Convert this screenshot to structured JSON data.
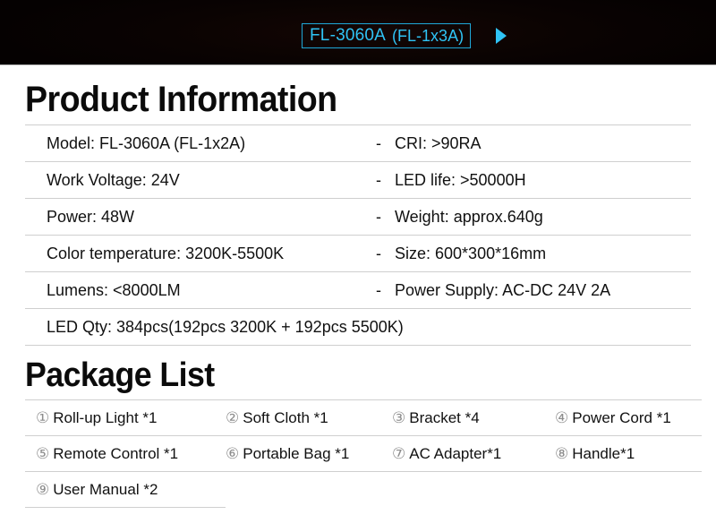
{
  "banner": {
    "model": "FL-3060A",
    "variant": "(FL-1x3A)",
    "arrow_icon": "play-triangle-icon",
    "background_color": "#060101",
    "accent_color": "#2fc3f5"
  },
  "sections": {
    "product_information": {
      "title": "Product Information",
      "rows": [
        {
          "left": "Model: FL-3060A (FL-1x2A)",
          "dash": "-",
          "right": "CRI:  >90RA"
        },
        {
          "left": "Work Voltage:  24V",
          "dash": "-",
          "right": "LED life: >50000H"
        },
        {
          "left": "Power: 48W",
          "dash": "-",
          "right": "Weight:  approx.640g"
        },
        {
          "left": "Color temperature: 3200K-5500K",
          "dash": "-",
          "right": "Size: 600*300*16mm"
        },
        {
          "left": "Lumens: <8000LM",
          "dash": "-",
          "right": "Power Supply:  AC-DC 24V 2A"
        }
      ],
      "full_width_row": "LED Qty: 384pcs(192pcs 3200K + 192pcs 5500K)"
    },
    "package_list": {
      "title": "Package List",
      "items": [
        {
          "number": "①",
          "label": "Roll-up Light *1"
        },
        {
          "number": "②",
          "label": "Soft Cloth *1"
        },
        {
          "number": "③",
          "label": "Bracket *4"
        },
        {
          "number": "④",
          "label": "Power Cord *1"
        },
        {
          "number": "⑤",
          "label": "Remote Control *1"
        },
        {
          "number": "⑥",
          "label": "Portable Bag *1"
        },
        {
          "number": "⑦",
          "label": "AC Adapter*1"
        },
        {
          "number": "⑧",
          "label": "Handle*1"
        },
        {
          "number": "⑨",
          "label": "User Manual *2"
        }
      ]
    }
  }
}
